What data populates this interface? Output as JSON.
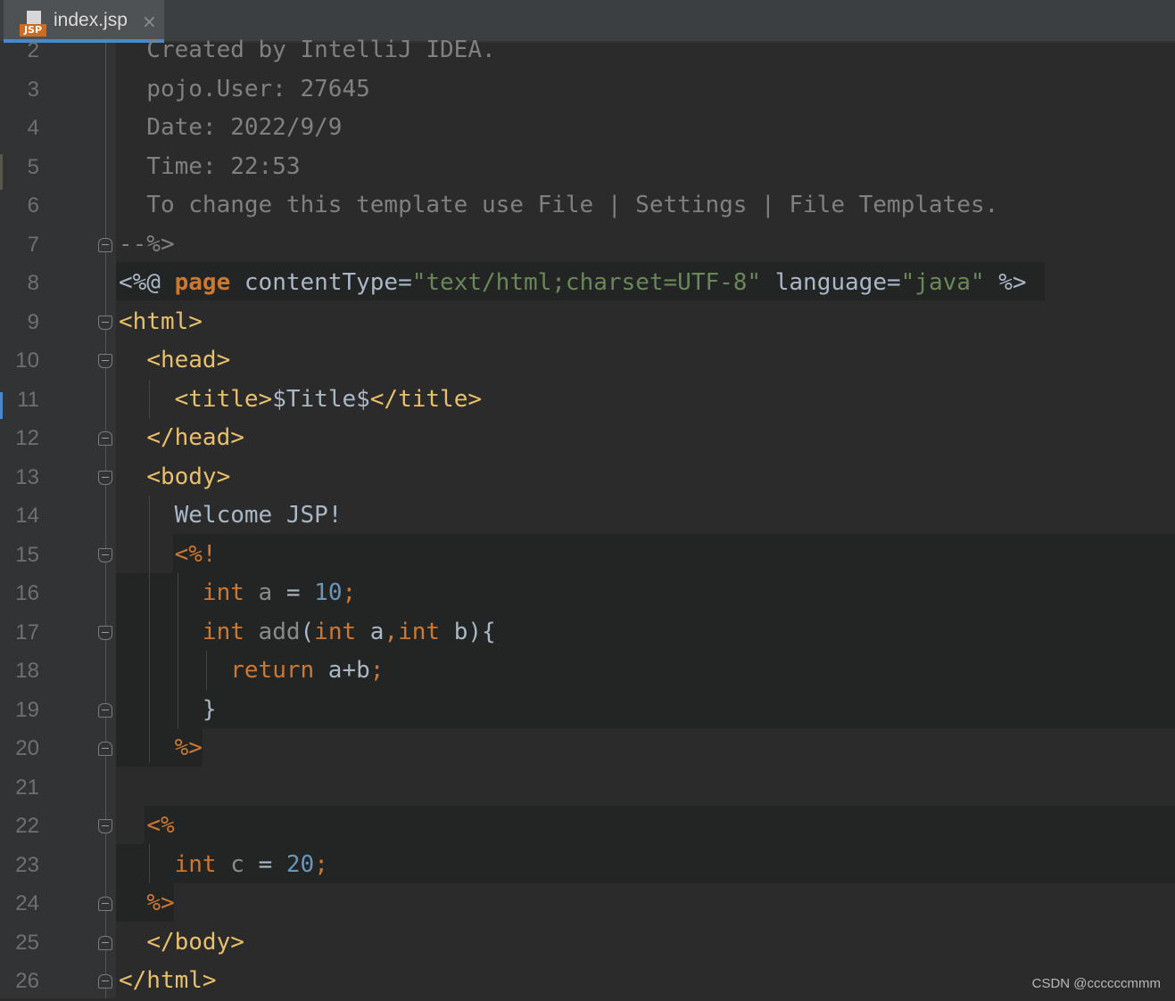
{
  "tab": {
    "icon": "jsp-file-icon",
    "icon_text": "JSP",
    "filename": "index.jsp",
    "close_glyph": "×"
  },
  "line_numbers": [
    "2",
    "3",
    "4",
    "5",
    "6",
    "7",
    "8",
    "9",
    "10",
    "11",
    "12",
    "13",
    "14",
    "15",
    "16",
    "17",
    "18",
    "19",
    "20",
    "21",
    "22",
    "23",
    "24",
    "25",
    "26"
  ],
  "lines": [
    [
      {
        "t": "  Created by IntelliJ IDEA.",
        "c": "cm"
      }
    ],
    [
      {
        "t": "  pojo.User: 27645",
        "c": "cm"
      }
    ],
    [
      {
        "t": "  Date: 2022/9/9",
        "c": "cm"
      }
    ],
    [
      {
        "t": "  Time: 22:53",
        "c": "cm"
      }
    ],
    [
      {
        "t": "  To change this template use File | Settings | File Templates.",
        "c": "cm"
      }
    ],
    [
      {
        "t": "--%>",
        "c": "cm"
      }
    ],
    [
      {
        "t": "<%@ ",
        "c": ""
      },
      {
        "t": "page",
        "c": "kwb"
      },
      {
        "t": " contentType=",
        "c": ""
      },
      {
        "t": "\"text/html;charset=UTF-8\"",
        "c": "st"
      },
      {
        "t": " language=",
        "c": ""
      },
      {
        "t": "\"java\"",
        "c": "st"
      },
      {
        "t": " %>",
        "c": ""
      }
    ],
    [
      {
        "t": "<html>",
        "c": "tg"
      }
    ],
    [
      {
        "t": "  ",
        "c": ""
      },
      {
        "t": "<head>",
        "c": "tg"
      }
    ],
    [
      {
        "t": "    ",
        "c": ""
      },
      {
        "t": "<title>",
        "c": "tg"
      },
      {
        "t": "$Title$",
        "c": ""
      },
      {
        "t": "</title>",
        "c": "tg"
      }
    ],
    [
      {
        "t": "  ",
        "c": ""
      },
      {
        "t": "</head>",
        "c": "tg"
      }
    ],
    [
      {
        "t": "  ",
        "c": ""
      },
      {
        "t": "<body>",
        "c": "tg"
      }
    ],
    [
      {
        "t": "    Welcome JSP!",
        "c": ""
      }
    ],
    [
      {
        "t": "    ",
        "c": ""
      },
      {
        "t": "<%!",
        "c": "kw"
      }
    ],
    [
      {
        "t": "      ",
        "c": ""
      },
      {
        "t": "int",
        "c": "kw"
      },
      {
        "t": " a ",
        "c": "dim"
      },
      {
        "t": "= ",
        "c": ""
      },
      {
        "t": "10",
        "c": "nu"
      },
      {
        "t": ";",
        "c": "kw"
      }
    ],
    [
      {
        "t": "      ",
        "c": ""
      },
      {
        "t": "int",
        "c": "kw"
      },
      {
        "t": " add",
        "c": "dim"
      },
      {
        "t": "(",
        "c": ""
      },
      {
        "t": "int",
        "c": "kw"
      },
      {
        "t": " a",
        "c": ""
      },
      {
        "t": ",",
        "c": "kw"
      },
      {
        "t": "int",
        "c": "kw"
      },
      {
        "t": " b){",
        "c": ""
      }
    ],
    [
      {
        "t": "        ",
        "c": ""
      },
      {
        "t": "return",
        "c": "kw"
      },
      {
        "t": " a+b",
        "c": ""
      },
      {
        "t": ";",
        "c": "kw"
      }
    ],
    [
      {
        "t": "      }",
        "c": ""
      }
    ],
    [
      {
        "t": "    ",
        "c": ""
      },
      {
        "t": "%>",
        "c": "kw"
      }
    ],
    [
      {
        "t": "",
        "c": ""
      }
    ],
    [
      {
        "t": "  ",
        "c": ""
      },
      {
        "t": "<%",
        "c": "kw"
      }
    ],
    [
      {
        "t": "    ",
        "c": ""
      },
      {
        "t": "int",
        "c": "kw"
      },
      {
        "t": " c ",
        "c": "dim"
      },
      {
        "t": "= ",
        "c": ""
      },
      {
        "t": "20",
        "c": "nu"
      },
      {
        "t": ";",
        "c": "kw"
      }
    ],
    [
      {
        "t": "  ",
        "c": ""
      },
      {
        "t": "%>",
        "c": "kw"
      }
    ],
    [
      {
        "t": "  ",
        "c": ""
      },
      {
        "t": "</body>",
        "c": "tg"
      }
    ],
    [
      {
        "t": "</html>",
        "c": "tg"
      }
    ]
  ],
  "watermark": "CSDN @ccccccmmm",
  "colors": {
    "background": "#2b2b2b",
    "gutter": "#313335",
    "tag": "#e8bf6a",
    "keyword": "#cc7832",
    "string": "#6a8759",
    "number": "#6897bb",
    "comment": "#808080",
    "text": "#a9b7c6",
    "accent": "#4a88c7"
  }
}
